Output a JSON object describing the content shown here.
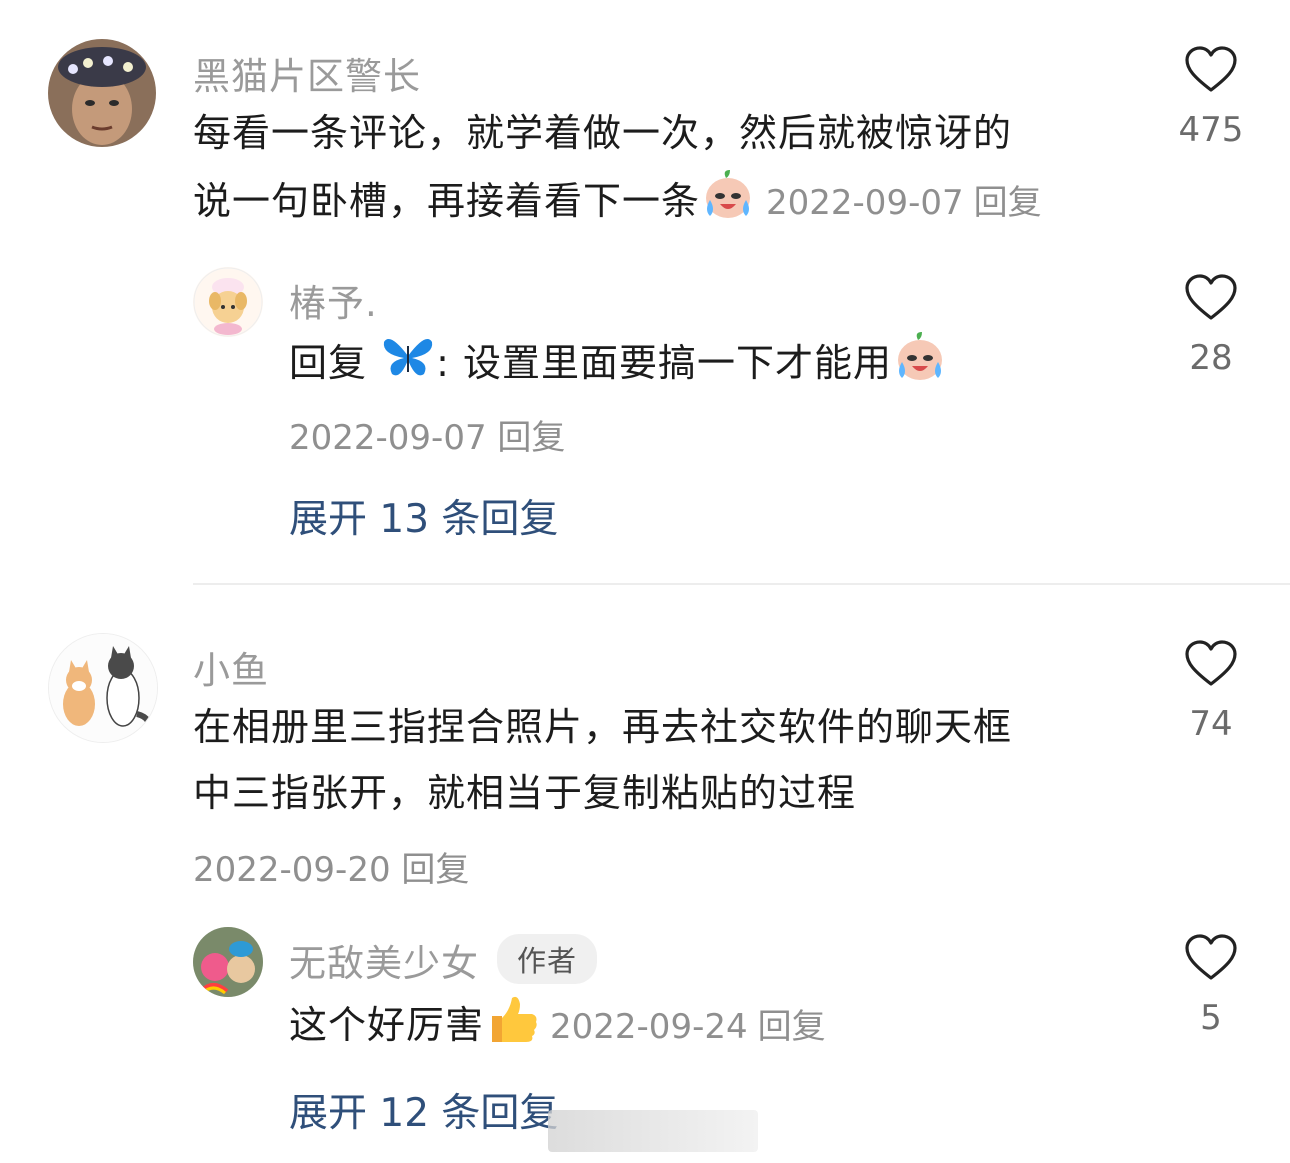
{
  "comments": [
    {
      "username": "黑猫片区警长",
      "text_line1": "每看一条评论，就学着做一次，然后就被惊讶的",
      "text_line2": "说一句卧槽，再接着看下一条",
      "date": "2022-09-07",
      "reply_label": "回复",
      "likes": "475",
      "emoji": "crying-laughing-face",
      "replies": [
        {
          "username": "椿予.",
          "text_prefix": "回复",
          "mention_emoji": "butterfly",
          "text": ": 设置里面要搞一下才能用",
          "emoji": "crying-laughing-face",
          "date": "2022-09-07",
          "reply_label": "回复",
          "likes": "28"
        }
      ],
      "expand_label": "展开 13 条回复"
    },
    {
      "username": "小鱼",
      "text_line1": "在相册里三指捏合照片，再去社交软件的聊天框",
      "text_line2": "中三指张开，就相当于复制粘贴的过程",
      "date": "2022-09-20",
      "reply_label": "回复",
      "likes": "74",
      "replies": [
        {
          "username": "无敌美少女",
          "badge": "作者",
          "text": "这个好厉害",
          "emoji": "thumbs-up",
          "date": "2022-09-24",
          "reply_label": "回复",
          "likes": "5"
        }
      ],
      "expand_label": "展开 12 条回复"
    }
  ],
  "colors": {
    "username": "#9a9a9a",
    "body_text": "#1c1c1c",
    "meta": "#8f8f8f",
    "link": "#2f4f7a",
    "divider": "#ededed"
  }
}
